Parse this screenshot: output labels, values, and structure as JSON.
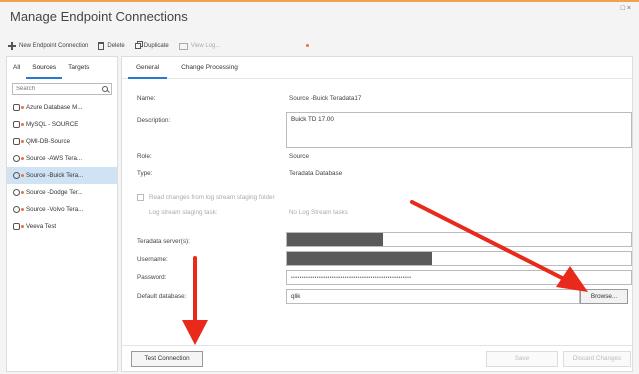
{
  "window": {
    "title": "Manage Endpoint Connections",
    "controls": "□ ×"
  },
  "toolbar": {
    "new_label": "New Endpoint Connection",
    "delete_label": "Delete",
    "duplicate_label": "Duplicate",
    "viewlog_label": "View Log..."
  },
  "left": {
    "tabs": [
      "All",
      "Sources",
      "Targets"
    ],
    "search_placeholder": "Search",
    "items": [
      "Azure Database M...",
      "MySQL - SOURCE",
      "QMI-DB-Source",
      "Source -AWS Tera...",
      "Source -Buick Tera...",
      "Source -Dodge Ter...",
      "Source -Volvo Tera...",
      "Veeva Test"
    ]
  },
  "right": {
    "tabs": [
      "General",
      "Change Processing"
    ],
    "name_label": "Name:",
    "name_value": "Source -Buick Teradata17",
    "description_label": "Description:",
    "description_value": "Buick TD 17.00",
    "role_label": "Role:",
    "role_value": "Source",
    "type_label": "Type:",
    "type_value": "Teradata Database",
    "read_changes_label": "Read changes from log stream staging folder",
    "log_stream_label": "Log stream staging task:",
    "log_stream_value": "No Log Stream tasks",
    "server_label": "Teradata server(s):",
    "username_label": "Username:",
    "password_label": "Password:",
    "password_value": "••••••••••••••••••••••••••••••••••••••••••••••••••••••••",
    "default_db_label": "Default database:",
    "default_db_value": "qlik",
    "browse_label": "Browse...",
    "test_connection_label": "Test Connection",
    "save_label": "Save",
    "discard_label": "Discard Changes"
  },
  "colors": {
    "accent": "#2a7bd0",
    "arrow": "#e8291c",
    "selected": "#cfe3f5",
    "window_accent": "#f0a050"
  }
}
